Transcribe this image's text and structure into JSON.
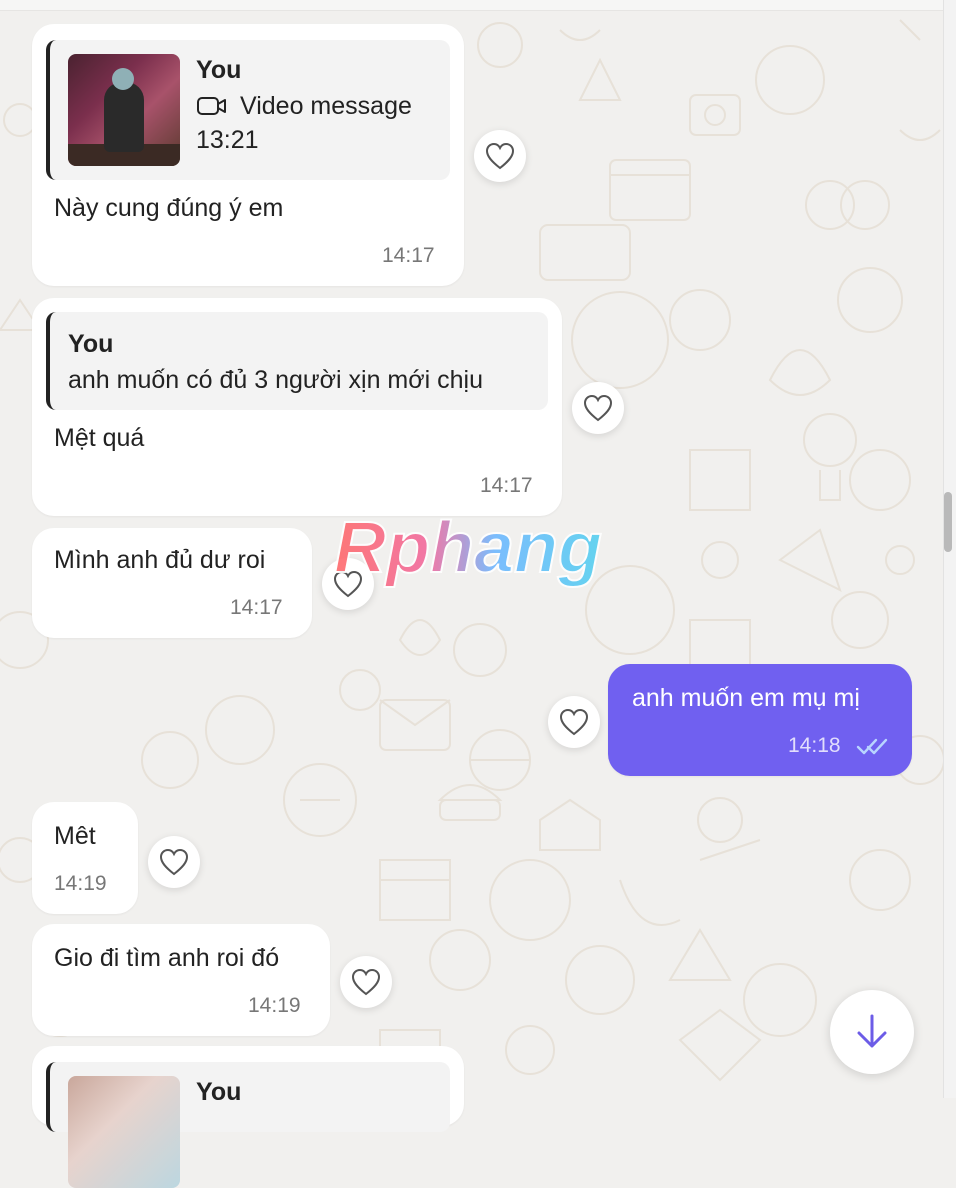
{
  "messages": [
    {
      "reply_author": "You",
      "reply_kind": "Video message",
      "reply_time": "13:21",
      "text": "Này cung đúng ý em",
      "time": "14:17"
    },
    {
      "reply_author": "You",
      "reply_text": "anh muốn có đủ 3 người xịn mới chịu",
      "text": "Mệt quá",
      "time": "14:17"
    },
    {
      "text": "Mình anh đủ dư roi",
      "time": "14:17"
    },
    {
      "text": "anh muốn em mụ mị",
      "time": "14:18",
      "outgoing": true,
      "read": true
    },
    {
      "text": "Mêt",
      "time": "14:19"
    },
    {
      "text": "Gio đi tìm anh roi đó",
      "time": "14:19"
    },
    {
      "reply_author": "You"
    }
  ],
  "watermark": "Rphang",
  "colors": {
    "outgoing": "#7060f0",
    "background": "#f1f0ee",
    "read_ticks": "#b8d4ff",
    "accent": "#7060f0"
  },
  "icons": {
    "heart": "heart-icon",
    "video": "video-camera-icon",
    "scroll_down": "arrow-down-icon",
    "read": "double-check-icon"
  }
}
